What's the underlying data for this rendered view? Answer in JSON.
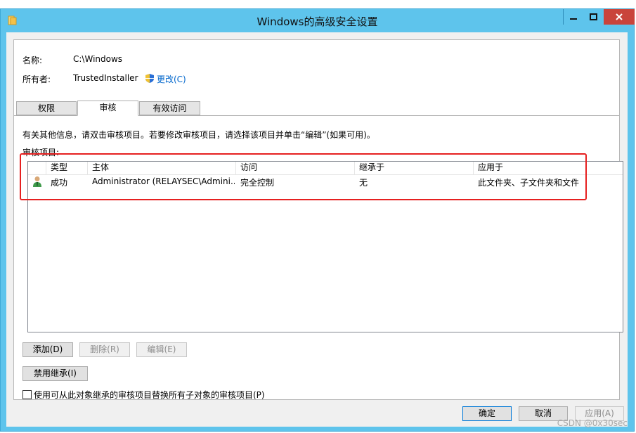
{
  "window": {
    "title": "Windows的高级安全设置"
  },
  "info": {
    "name_label": "名称:",
    "name_value": "C:\\Windows",
    "owner_label": "所有者:",
    "owner_value": "TrustedInstaller",
    "change_link": "更改(C)"
  },
  "tabs": [
    {
      "label": "权限"
    },
    {
      "label": "审核"
    },
    {
      "label": "有效访问"
    }
  ],
  "instructions": "有关其他信息，请双击审核项目。若要修改审核项目，请选择该项目并单击“编辑”(如果可用)。",
  "entries_label": "审核项目:",
  "table": {
    "headers": [
      "类型",
      "主体",
      "访问",
      "继承于",
      "应用于"
    ],
    "rows": [
      {
        "type": "成功",
        "principal": "Administrator (RELAYSEC\\Admini...",
        "access": "完全控制",
        "inherited": "无",
        "applies": "此文件夹、子文件夹和文件"
      }
    ]
  },
  "buttons": {
    "add": "添加(D)",
    "remove": "删除(R)",
    "edit": "编辑(E)",
    "disable_inheritance": "禁用继承(I)",
    "ok": "确定",
    "cancel": "取消",
    "apply": "应用(A)"
  },
  "replace_checkbox": {
    "label": "使用可从此对象继承的审核项目替换所有子对象的审核项目(P)",
    "checked": false
  },
  "watermark": "CSDN @0x30sec",
  "colors": {
    "titlebar": "#5ec4ec",
    "close": "#c9443b",
    "link": "#0066cc",
    "highlight": "#e62020"
  }
}
